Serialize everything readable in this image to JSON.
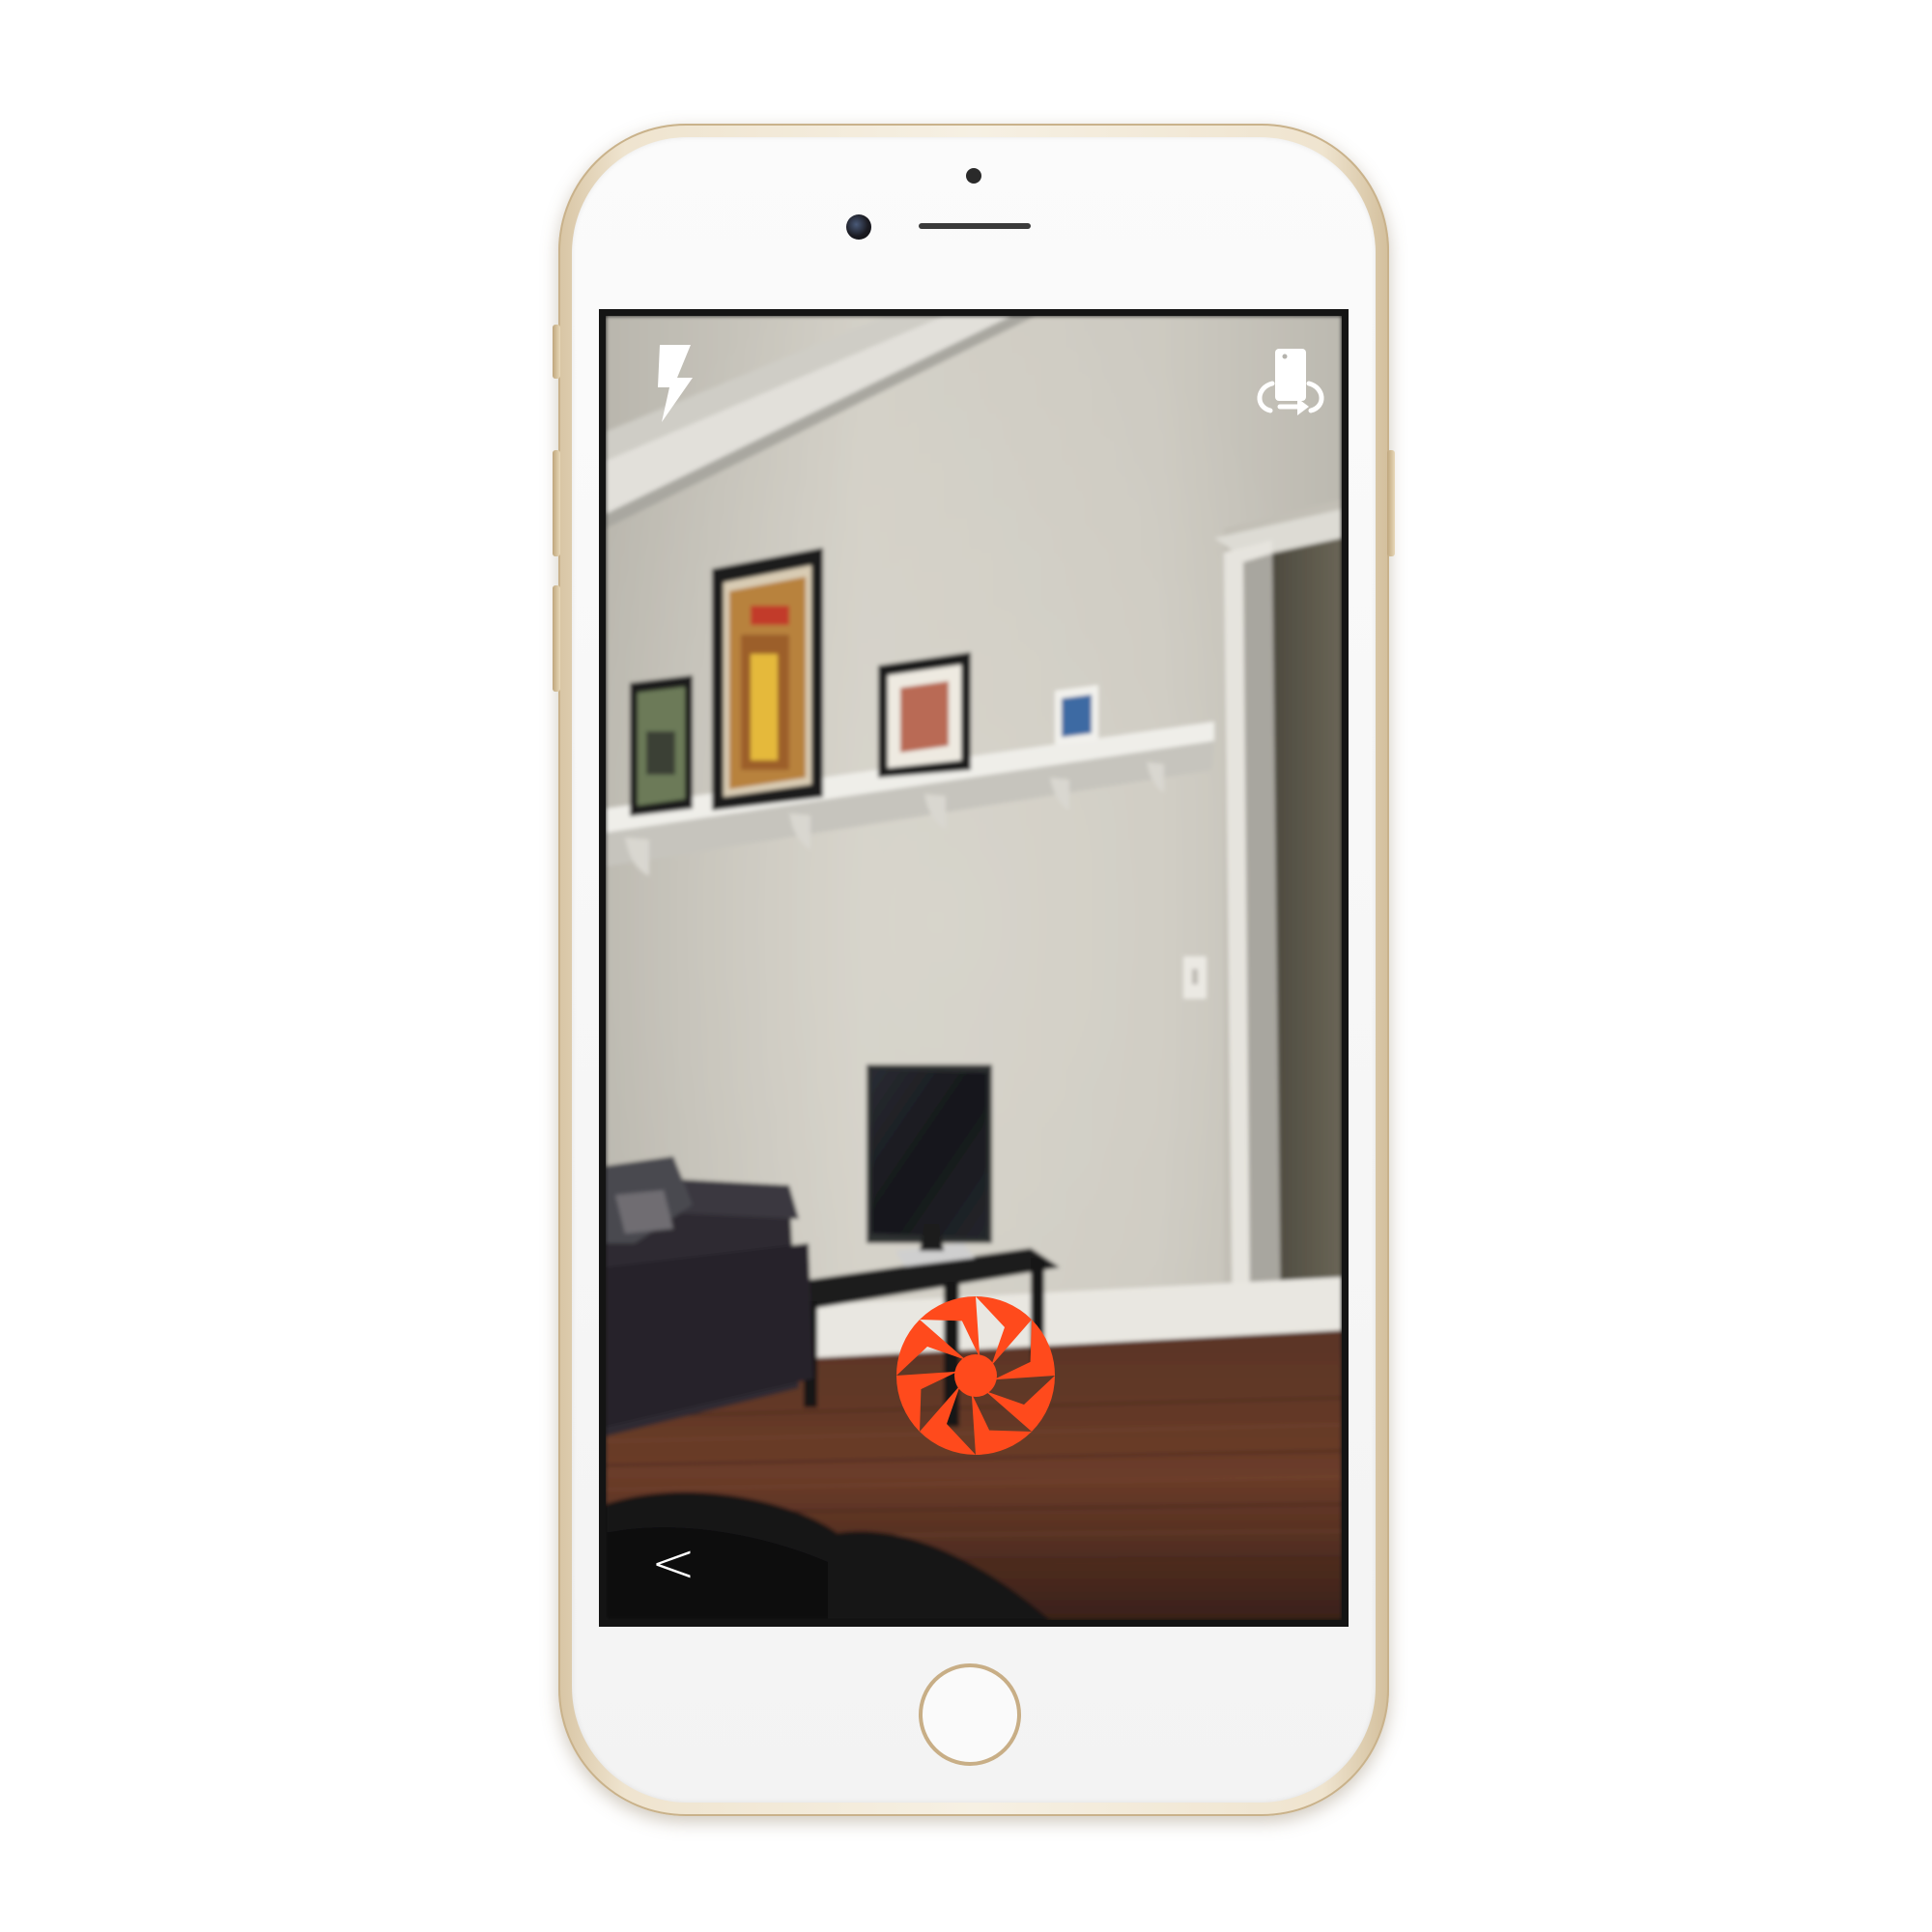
{
  "app": {
    "screen": "camera-viewfinder"
  },
  "toolbar": {
    "flash_icon": "flash-icon",
    "switch_camera_icon": "switch-camera-icon"
  },
  "controls": {
    "back_label": "<",
    "shutter_icon": "aperture-icon"
  },
  "colors": {
    "accent": "#ff4a1c",
    "icon": "#ffffff",
    "phone_trim": "#d8c5a4"
  }
}
